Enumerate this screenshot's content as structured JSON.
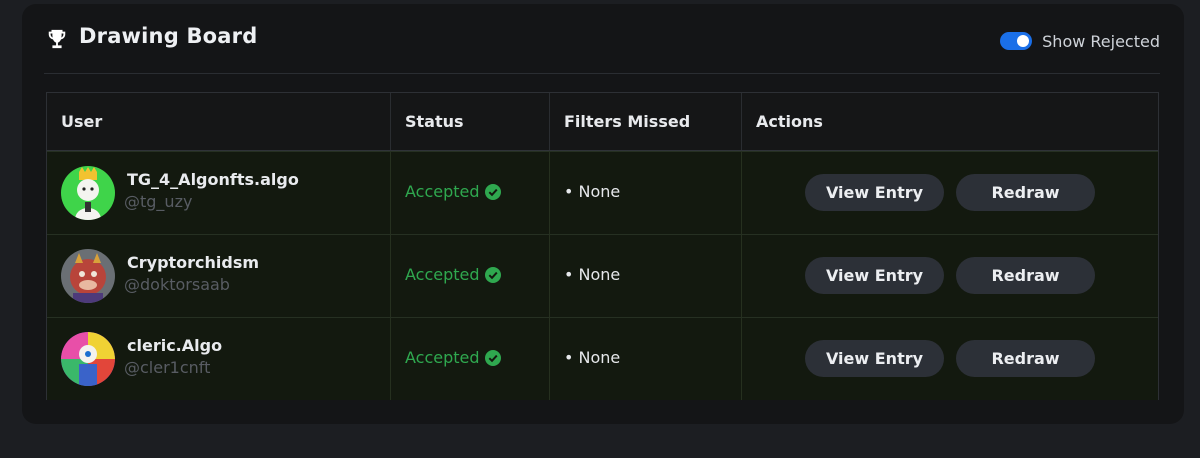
{
  "header": {
    "title": "Drawing Board",
    "toggle_label": "Show Rejected",
    "toggle_on": true
  },
  "colors": {
    "accent": "#1a6fe8",
    "accepted": "#2fa84f",
    "row_bg": "#13190f",
    "button_bg": "#2c3037"
  },
  "table": {
    "columns": [
      "User",
      "Status",
      "Filters Missed",
      "Actions"
    ],
    "rows": [
      {
        "name": "TG_4_Algonfts.algo",
        "handle": "@tg_uzy",
        "status": "Accepted",
        "filters": "• None",
        "view_label": "View Entry",
        "redraw_label": "Redraw"
      },
      {
        "name": "Cryptorchidsm",
        "handle": "@doktorsaab",
        "status": "Accepted",
        "filters": "• None",
        "view_label": "View Entry",
        "redraw_label": "Redraw"
      },
      {
        "name": "cleric.Algo",
        "handle": "@cler1cnft",
        "status": "Accepted",
        "filters": "• None",
        "view_label": "View Entry",
        "redraw_label": "Redraw"
      }
    ]
  }
}
